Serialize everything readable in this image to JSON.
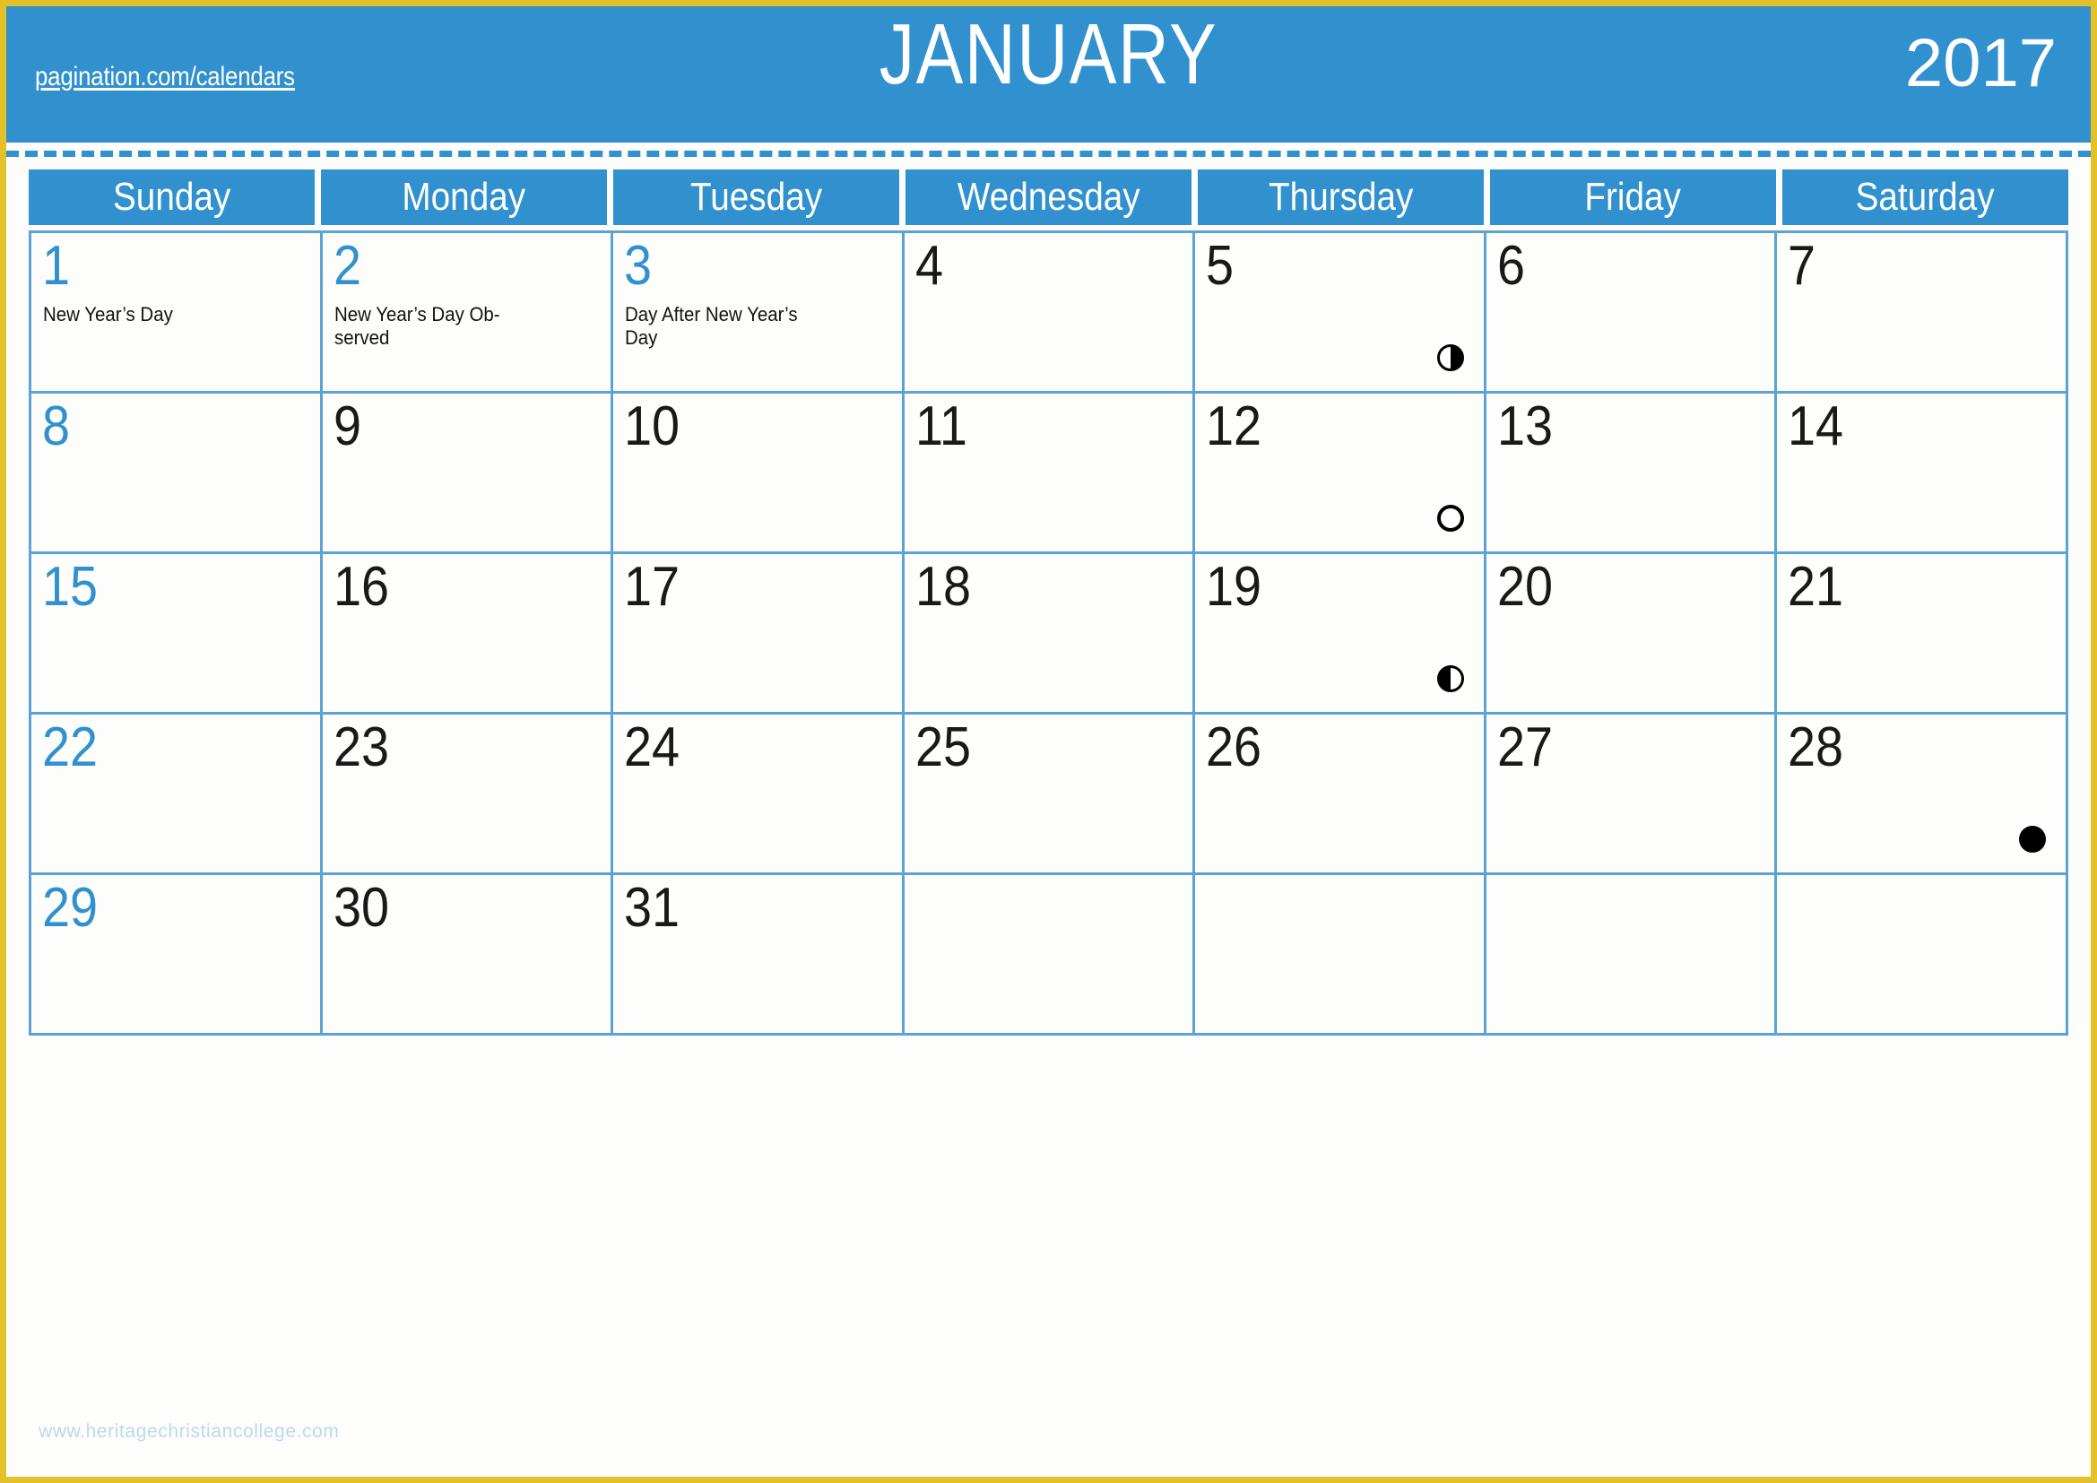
{
  "page": {
    "border_color": "#e3c229",
    "background": "#fdfdfc",
    "watermark": "www.heritagechristiancollege.com"
  },
  "header": {
    "site_url": "pagination.com/calendars",
    "month": "JANUARY",
    "year": "2017",
    "band_color": "#3191ce",
    "text_color": "#ffffff"
  },
  "weekdays": [
    {
      "label": "Sunday"
    },
    {
      "label": "Monday"
    },
    {
      "label": "Tuesday"
    },
    {
      "label": "Wednesday"
    },
    {
      "label": "Thursday"
    },
    {
      "label": "Friday"
    },
    {
      "label": "Saturday"
    }
  ],
  "colors": {
    "accent": "#3191ce",
    "grid_line": "#5ba3d4",
    "day_number": "#191919",
    "event_text": "#121212"
  },
  "weeks": [
    {
      "days": [
        {
          "number": "1",
          "accent": true,
          "event": "New Year’s Day",
          "moon": ""
        },
        {
          "number": "2",
          "accent": true,
          "event": "New Year’s Day Ob-\nserved",
          "moon": ""
        },
        {
          "number": "3",
          "accent": true,
          "event": "Day After New Year’s\nDay",
          "moon": ""
        },
        {
          "number": "4",
          "accent": false,
          "event": "",
          "moon": ""
        },
        {
          "number": "5",
          "accent": false,
          "event": "",
          "moon": "first-quarter"
        },
        {
          "number": "6",
          "accent": false,
          "event": "",
          "moon": ""
        },
        {
          "number": "7",
          "accent": false,
          "event": "",
          "moon": ""
        }
      ]
    },
    {
      "days": [
        {
          "number": "8",
          "accent": true,
          "event": "",
          "moon": ""
        },
        {
          "number": "9",
          "accent": false,
          "event": "",
          "moon": ""
        },
        {
          "number": "10",
          "accent": false,
          "event": "",
          "moon": ""
        },
        {
          "number": "11",
          "accent": false,
          "event": "",
          "moon": ""
        },
        {
          "number": "12",
          "accent": false,
          "event": "",
          "moon": "full"
        },
        {
          "number": "13",
          "accent": false,
          "event": "",
          "moon": ""
        },
        {
          "number": "14",
          "accent": false,
          "event": "",
          "moon": ""
        }
      ]
    },
    {
      "days": [
        {
          "number": "15",
          "accent": true,
          "event": "",
          "moon": ""
        },
        {
          "number": "16",
          "accent": false,
          "event": "",
          "moon": ""
        },
        {
          "number": "17",
          "accent": false,
          "event": "",
          "moon": ""
        },
        {
          "number": "18",
          "accent": false,
          "event": "",
          "moon": ""
        },
        {
          "number": "19",
          "accent": false,
          "event": "",
          "moon": "last-quarter"
        },
        {
          "number": "20",
          "accent": false,
          "event": "",
          "moon": ""
        },
        {
          "number": "21",
          "accent": false,
          "event": "",
          "moon": ""
        }
      ]
    },
    {
      "days": [
        {
          "number": "22",
          "accent": true,
          "event": "",
          "moon": ""
        },
        {
          "number": "23",
          "accent": false,
          "event": "",
          "moon": ""
        },
        {
          "number": "24",
          "accent": false,
          "event": "",
          "moon": ""
        },
        {
          "number": "25",
          "accent": false,
          "event": "",
          "moon": ""
        },
        {
          "number": "26",
          "accent": false,
          "event": "",
          "moon": ""
        },
        {
          "number": "27",
          "accent": false,
          "event": "",
          "moon": ""
        },
        {
          "number": "28",
          "accent": false,
          "event": "",
          "moon": "new"
        }
      ]
    },
    {
      "days": [
        {
          "number": "29",
          "accent": true,
          "event": "",
          "moon": ""
        },
        {
          "number": "30",
          "accent": false,
          "event": "",
          "moon": ""
        },
        {
          "number": "31",
          "accent": false,
          "event": "",
          "moon": ""
        },
        {
          "number": "",
          "accent": false,
          "event": "",
          "moon": ""
        },
        {
          "number": "",
          "accent": false,
          "event": "",
          "moon": ""
        },
        {
          "number": "",
          "accent": false,
          "event": "",
          "moon": ""
        },
        {
          "number": "",
          "accent": false,
          "event": "",
          "moon": ""
        }
      ]
    }
  ]
}
